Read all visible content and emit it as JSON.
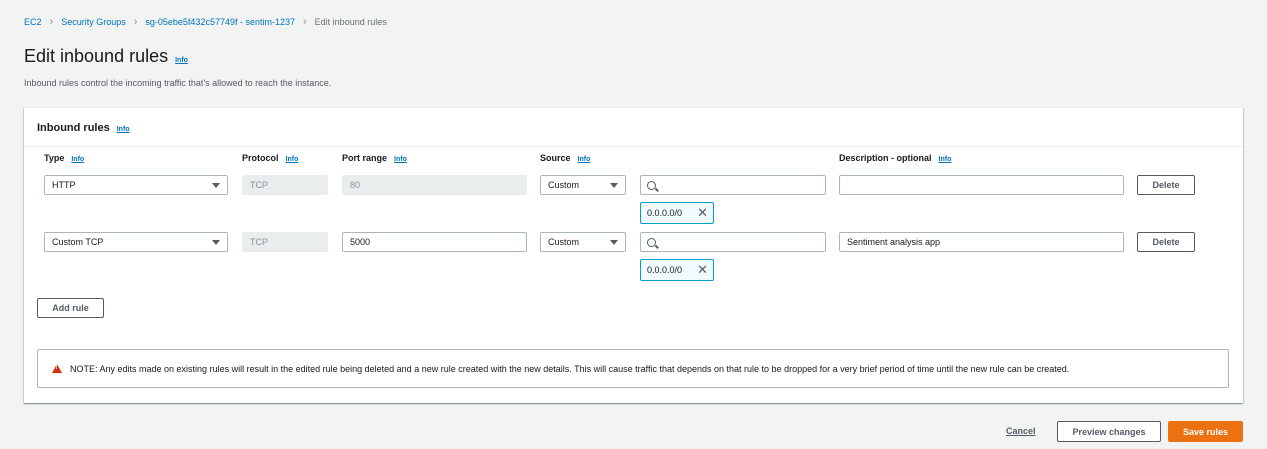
{
  "breadcrumb": {
    "items": [
      "EC2",
      "Security Groups",
      "sg-05ebe5f432c57749f - sentim-1237"
    ],
    "current": "Edit inbound rules"
  },
  "page": {
    "title": "Edit inbound rules",
    "title_info": "Info",
    "subtitle": "Inbound rules control the incoming traffic that's allowed to reach the instance."
  },
  "panel": {
    "title": "Inbound rules",
    "title_info": "Info",
    "columns": {
      "type": "Type",
      "protocol": "Protocol",
      "port_range": "Port range",
      "source": "Source",
      "description": "Description - optional",
      "info": "Info"
    },
    "rules": [
      {
        "type": "HTTP",
        "protocol": "TCP",
        "port_range": "80",
        "source": "Custom",
        "search_value": "",
        "cidr": "0.0.0.0/0",
        "description": "",
        "delete": "Delete"
      },
      {
        "type": "Custom TCP",
        "protocol": "TCP",
        "port_range": "5000",
        "source": "Custom",
        "search_value": "",
        "cidr": "0.0.0.0/0",
        "description": "Sentiment analysis app",
        "delete": "Delete"
      }
    ],
    "add_rule": "Add rule",
    "note": "NOTE: Any edits made on existing rules will result in the edited rule being deleted and a new rule created with the new details. This will cause traffic that depends on that rule to be dropped for a very brief period of time until the new rule can be created."
  },
  "footer": {
    "cancel": "Cancel",
    "preview": "Preview changes",
    "save": "Save rules"
  },
  "colors": {
    "link": "#0073bb",
    "primary": "#ec7211",
    "token_border": "#00a1c9",
    "warning": "#d13212"
  }
}
